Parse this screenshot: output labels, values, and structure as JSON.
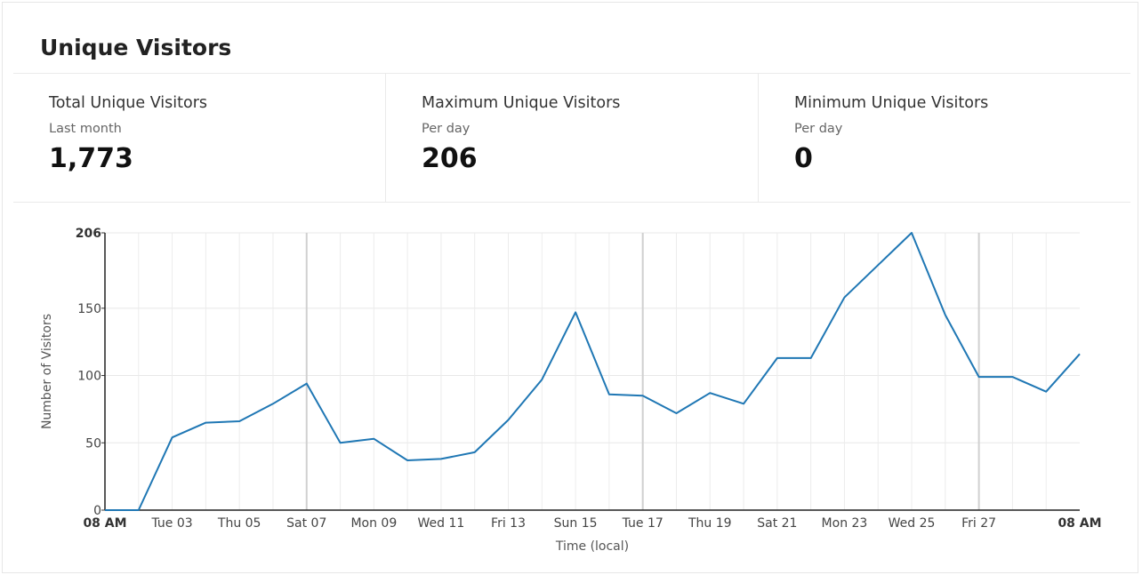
{
  "panel": {
    "title": "Unique Visitors"
  },
  "stats": [
    {
      "title": "Total Unique Visitors",
      "subtitle": "Last month",
      "value": "1,773"
    },
    {
      "title": "Maximum Unique Visitors",
      "subtitle": "Per day",
      "value": "206"
    },
    {
      "title": "Minimum Unique Visitors",
      "subtitle": "Per day",
      "value": "0"
    }
  ],
  "chart_data": {
    "type": "line",
    "xlabel": "Time (local)",
    "ylabel": "Number of Visitors",
    "ylim": [
      0,
      206
    ],
    "yticks": [
      0,
      50,
      100,
      150,
      206
    ],
    "xticks": [
      "08 AM",
      "Tue 03",
      "Thu 05",
      "Sat 07",
      "Mon 09",
      "Wed 11",
      "Fri 13",
      "Sun 15",
      "Tue 17",
      "Thu 19",
      "Sat 21",
      "Mon 23",
      "Wed 25",
      "Fri 27",
      "08 AM"
    ],
    "xtick_positions_days": [
      0,
      2,
      4,
      6,
      8,
      10,
      12,
      14,
      16,
      18,
      20,
      22,
      24,
      26,
      29
    ],
    "bold_ticks": [
      0,
      14
    ],
    "major_gridline_days": [
      6,
      16,
      26
    ],
    "x_range_days": [
      0,
      29
    ],
    "grid": true,
    "color": "#1f77b4",
    "series": [
      {
        "x_days": [
          0,
          1,
          2,
          3,
          4,
          5,
          6,
          7,
          8,
          9,
          10,
          11,
          12,
          13,
          14,
          15,
          16,
          17,
          18,
          19,
          20,
          21,
          22,
          23,
          24,
          25,
          26,
          27,
          28,
          29
        ],
        "values": [
          0,
          0,
          54,
          65,
          66,
          79,
          94,
          50,
          53,
          37,
          38,
          43,
          67,
          97,
          147,
          86,
          85,
          72,
          87,
          79,
          113,
          113,
          158,
          182,
          206,
          145,
          99,
          99,
          88,
          116
        ]
      }
    ]
  }
}
